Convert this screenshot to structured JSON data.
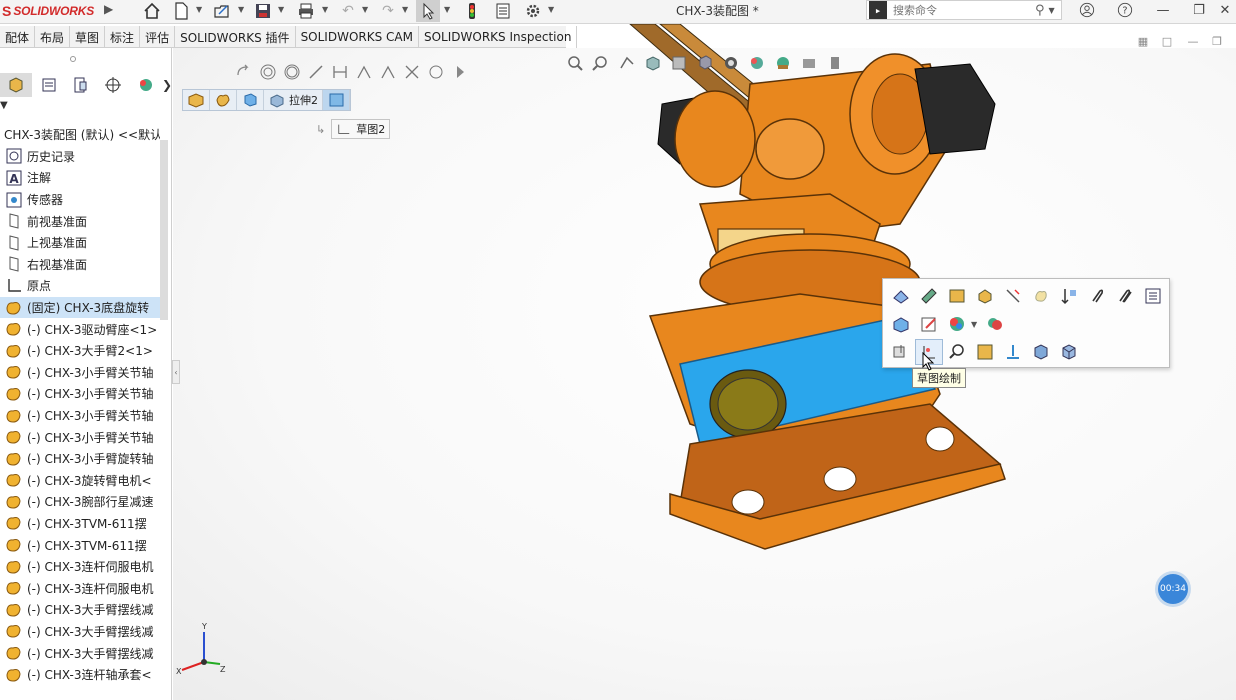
{
  "app": {
    "name": "SOLIDWORKS",
    "doc_title": "CHX-3装配图 *"
  },
  "search": {
    "placeholder": "搜索命令",
    "prompt_symbol": "▶"
  },
  "tabs": [
    {
      "label": "配体"
    },
    {
      "label": "布局"
    },
    {
      "label": "草图"
    },
    {
      "label": "标注"
    },
    {
      "label": "评估"
    },
    {
      "label": "SOLIDWORKS 插件"
    },
    {
      "label": "SOLIDWORKS CAM"
    },
    {
      "label": "SOLIDWORKS Inspection"
    }
  ],
  "breadcrumb": {
    "extrude_label": "拉伸2",
    "sketch_label": "草图2"
  },
  "tree": [
    {
      "label": "CHX-3装配图 (默认) <<默认",
      "icon": "assembly-icon",
      "top": true
    },
    {
      "label": "历史记录",
      "icon": "history-icon"
    },
    {
      "label": "注解",
      "icon": "annotation-icon"
    },
    {
      "label": "传感器",
      "icon": "sensor-icon"
    },
    {
      "label": "前视基准面",
      "icon": "plane-icon"
    },
    {
      "label": "上视基准面",
      "icon": "plane-icon"
    },
    {
      "label": "右视基准面",
      "icon": "plane-icon"
    },
    {
      "label": "原点",
      "icon": "origin-icon"
    },
    {
      "label": "(固定) CHX-3底盘旋转",
      "icon": "part-icon",
      "selected": true
    },
    {
      "label": "(-) CHX-3驱动臂座<1>",
      "icon": "part-icon"
    },
    {
      "label": "(-) CHX-3大手臂2<1>",
      "icon": "part-icon"
    },
    {
      "label": "(-) CHX-3小手臂关节轴",
      "icon": "part-icon"
    },
    {
      "label": "(-) CHX-3小手臂关节轴",
      "icon": "part-icon"
    },
    {
      "label": "(-) CHX-3小手臂关节轴",
      "icon": "part-icon"
    },
    {
      "label": "(-) CHX-3小手臂关节轴",
      "icon": "part-icon"
    },
    {
      "label": "(-) CHX-3小手臂旋转轴",
      "icon": "part-icon"
    },
    {
      "label": "(-) CHX-3旋转臂电机<",
      "icon": "part-icon"
    },
    {
      "label": "(-) CHX-3腕部行星减速",
      "icon": "part-icon"
    },
    {
      "label": "(-) CHX-3TVM-611摆",
      "icon": "part-icon"
    },
    {
      "label": "(-) CHX-3TVM-611摆",
      "icon": "part-icon"
    },
    {
      "label": "(-) CHX-3连杆伺服电机",
      "icon": "part-icon"
    },
    {
      "label": "(-) CHX-3连杆伺服电机",
      "icon": "part-icon"
    },
    {
      "label": "(-) CHX-3大手臂摆线减",
      "icon": "part-icon"
    },
    {
      "label": "(-) CHX-3大手臂摆线减",
      "icon": "part-icon"
    },
    {
      "label": "(-) CHX-3大手臂摆线减",
      "icon": "part-icon"
    },
    {
      "label": "(-) CHX-3连杆轴承套<",
      "icon": "part-icon"
    }
  ],
  "context_menu": {
    "tooltip": "草图绘制"
  },
  "timer": {
    "label": "00:34"
  },
  "triad": {
    "x_label": "X",
    "y_label": "Y",
    "z_label": "Z"
  },
  "colors": {
    "part_orange": "#e8871e",
    "panel_blue": "#2aa6ec",
    "accent_red": "#d22b2b",
    "selection": "#cde3f7"
  }
}
